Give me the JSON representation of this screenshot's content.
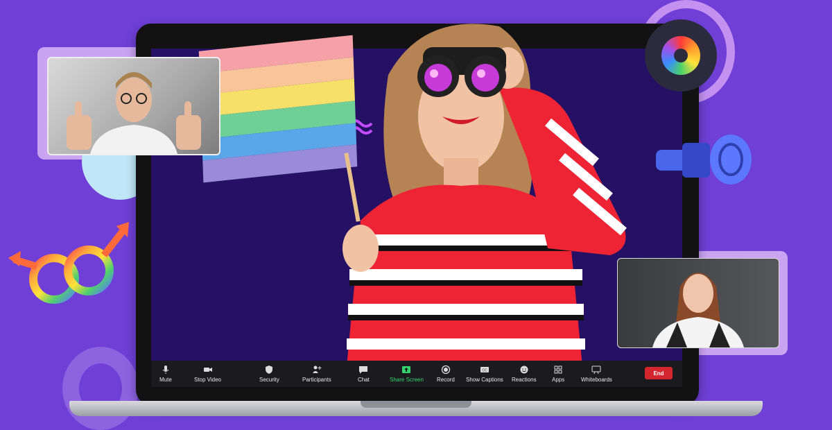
{
  "toolbar": {
    "buttons": [
      {
        "label": "Mute",
        "icon": "microphone-icon"
      },
      {
        "label": "Stop Video",
        "icon": "video-camera-icon"
      },
      {
        "label": "Security",
        "icon": "shield-icon"
      },
      {
        "label": "Participants",
        "icon": "participants-icon"
      },
      {
        "label": "Chat",
        "icon": "chat-icon"
      },
      {
        "label": "Share Screen",
        "icon": "share-screen-icon"
      },
      {
        "label": "Record",
        "icon": "record-icon"
      },
      {
        "label": "Show Captions",
        "icon": "captions-icon"
      },
      {
        "label": "Reactions",
        "icon": "reactions-icon"
      },
      {
        "label": "Apps",
        "icon": "apps-icon"
      },
      {
        "label": "Whiteboards",
        "icon": "whiteboard-icon"
      }
    ],
    "end_label": "End",
    "share_color": "#35d36e",
    "end_color": "#d3262e"
  },
  "colors": {
    "background": "#6f3fd6",
    "screen": "#241164",
    "flag": [
      "#f6a0a8",
      "#f9c49a",
      "#f6e06a",
      "#6fcf97",
      "#5aa6e8",
      "#9a8bd8"
    ]
  }
}
